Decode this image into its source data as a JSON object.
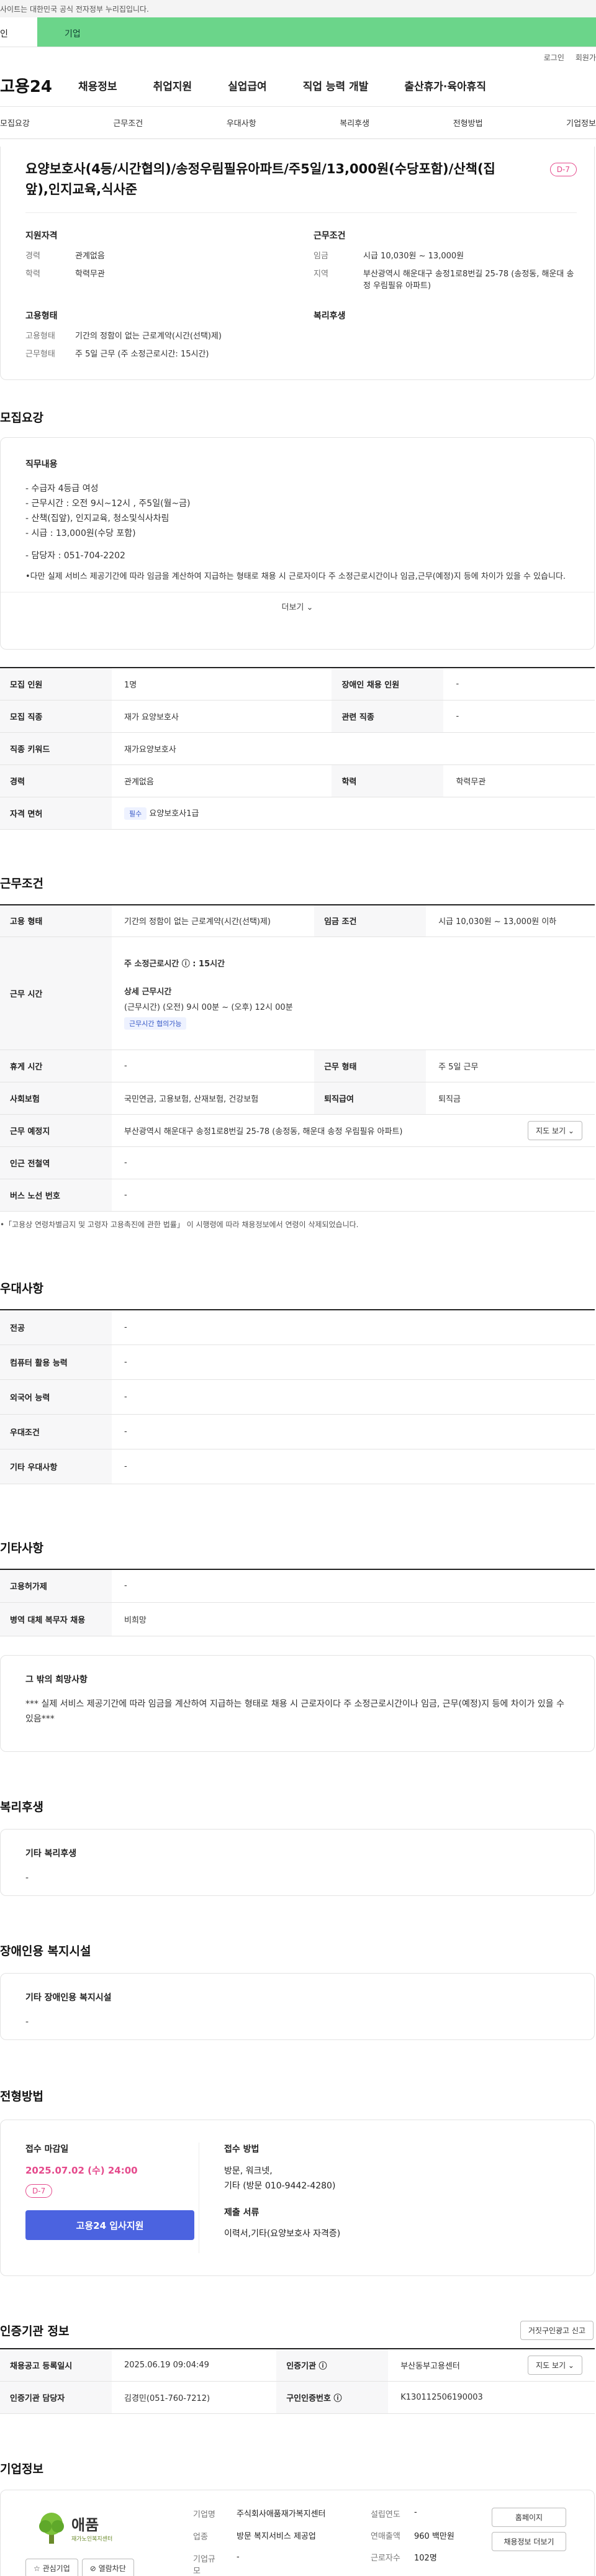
{
  "topbar": {
    "notice": "사이트는 대한민국 공식 전자정부 누리집입니다."
  },
  "typebar": {
    "personal": "인",
    "company": "기업"
  },
  "util": {
    "login": "로그인",
    "signup": "회원가"
  },
  "gnb": {
    "logo": "고용24",
    "menu": [
      "채용정보",
      "취업지원",
      "실업급여",
      "직업 능력 개발",
      "출산휴가·육아휴직"
    ]
  },
  "tabs": [
    "모집요강",
    "근무조건",
    "우대사항",
    "복리후생",
    "전형방법",
    "기업정보"
  ],
  "summary": {
    "title": "요양보호사(4등/시간협의)/송정우림필유아파트/주5일/13,000원(수당포함)/산책(집앞),인지교육,식사준",
    "dday": "D-7",
    "qual_title": "지원자격",
    "qual": [
      {
        "k": "경력",
        "v": "관계없음"
      },
      {
        "k": "학력",
        "v": "학력무관"
      }
    ],
    "work_title": "근무조건",
    "work": [
      {
        "k": "임금",
        "v": "시급 10,030원 ~ 13,000원"
      },
      {
        "k": "지역",
        "v": "부산광역시 해운대구 송정1로8번길 25-78 (송정동, 해운대 송정 우림필유 아파트)"
      }
    ],
    "emp_title": "고용형태",
    "emp": [
      {
        "k": "고용형태",
        "v": "기간의 정함이 없는 근로계약(시간(선택)제)"
      },
      {
        "k": "근무형태",
        "v": "주 5일 근무 (주 소정근로시간: 15시간)"
      }
    ],
    "welfare_title": "복리후생"
  },
  "recruit": {
    "section": "모집요강",
    "head": "직무내용",
    "lines": [
      "- 수급자 4등급 여성",
      "- 근무시간 : 오전 9시~12시 , 주5일(월~금)",
      "- 산책(집앞), 인지교육, 청소및식사차림",
      "- 시급 : 13,000원(수당 포함)",
      "",
      "- 담당자 : 051-704-2202",
      "",
      "•다만 실제 서비스 제공기간에 따라 임금을 계산하여 지급하는 형태로 채용 시 근로자이다 주 소정근로시간이나 임금,근무(예정)지 등에 차이가 있을 수 있습니다."
    ],
    "more": "더보기 ⌄",
    "table": [
      {
        "k1": "모집 인원",
        "v1": "1명",
        "k2": "장애인 채용 인원",
        "v2": "-"
      },
      {
        "k1": "모집 직종",
        "v1": "재가 요양보호사",
        "k2": "관련 직종",
        "v2": "-"
      },
      {
        "k1": "직종 키워드",
        "v1": "재가요양보호사"
      },
      {
        "k1": "경력",
        "v1": "관계없음",
        "k2": "학력",
        "v2": "학력무관"
      },
      {
        "k1": "자격 면허",
        "tag": "필수",
        "v1": "요양보호사1급"
      }
    ]
  },
  "workcond": {
    "section": "근무조건",
    "emp_type_k": "고용 형태",
    "emp_type_v": "기간의 정함이 없는 근로계약(시간(선택)제)",
    "wage_k": "임금 조건",
    "wage_v": "시급 10,030원 ~ 13,000원 이하",
    "hours_k": "근무 시간",
    "hours_weekly": "주 소정근로시간 ⓘ : 15시간",
    "hours_detail_h": "상세 근무시간",
    "hours_detail_v": "(근무시간) (오전) 9시 00분 ~ (오후) 12시 00분",
    "hours_tag": "근무시간 협의가능",
    "rest_k": "휴게 시간",
    "rest_v": "-",
    "form_k": "근무 형태",
    "form_v": "주 5일 근무",
    "ins_k": "사회보험",
    "ins_v": "국민연금, 고용보험, 산재보험, 건강보험",
    "sev_k": "퇴직급여",
    "sev_v": "퇴직금",
    "place_k": "근무 예정지",
    "place_v": "부산광역시 해운대구 송정1로8번길 25-78 (송정동, 해운대 송정 우림필유 아파트)",
    "map": "지도 보기 ⌄",
    "station_k": "인근 전철역",
    "station_v": "-",
    "bus_k": "버스 노선 번호",
    "bus_v": "-",
    "note": "•「고용상 연령차별금지 및 고령자 고용촉진에 관한 법률」 이 시행령에 따라 채용정보에서 연령이 삭제되었습니다."
  },
  "pref": {
    "section": "우대사항",
    "rows": [
      {
        "k": "전공",
        "v": "-"
      },
      {
        "k": "컴퓨터 활용 능력",
        "v": "-"
      },
      {
        "k": "외국어 능력",
        "v": "-"
      },
      {
        "k": "우대조건",
        "v": "-"
      },
      {
        "k": "기타 우대사항",
        "v": "-"
      }
    ]
  },
  "etc": {
    "section": "기타사항",
    "rows": [
      {
        "k": "고용허가제",
        "v": "-"
      },
      {
        "k": "병역 대체 복무자 채용",
        "v": "비희망"
      }
    ],
    "box_h": "그 밖의 희망사항",
    "box_v": "*** 실제 서비스 제공기간에 따라 임금을 계산하여 지급하는 형태로 채용 시 근로자이다 주 소정근로시간이나 임금, 근무(예정)지 등에 차이가 있을 수 있음***"
  },
  "welfare": {
    "section": "복리후생",
    "h": "기타 복리후생",
    "v": "-"
  },
  "disab": {
    "section": "장애인용 복지시설",
    "h": "기타 장애인용 복지시설",
    "v": "-"
  },
  "apply": {
    "section": "전형방법",
    "deadline_h": "접수 마감일",
    "deadline_v": "2025.07.02 (수) 24:00",
    "dday": "D-7",
    "btn": "고용24 입사지원",
    "method_h": "접수 방법",
    "method_v1": "방문, 워크넷,",
    "method_v2": "기타 (방문 010-9442-4280)",
    "docs_h": "제출 서류",
    "docs_v": "이력서,기타(요양보호사 자격증)"
  },
  "cert": {
    "section": "인증기관 정보",
    "report": "거짓구인광고 신고",
    "rows": [
      {
        "k1": "채용공고 등록일시",
        "v1": "2025.06.19 09:04:49",
        "k2": "인증기관 ⓘ",
        "v2": "부산동부고용센터",
        "btn": "지도 보기 ⌄"
      },
      {
        "k1": "인증기관 담당자",
        "v1": "김경민(051-760-7212)",
        "k2": "구인인증번호 ⓘ",
        "v2": "K130112506190003"
      }
    ]
  },
  "company": {
    "section": "기업정보",
    "logo": "애품",
    "logo_sub": "재가노인복지센터",
    "fav": "☆ 관심기업",
    "block": "⊘ 열람차단",
    "name_k": "기업명",
    "name_v": "주식회사애품재가복지센터",
    "ind_k": "업종",
    "ind_v": "방문 복지서비스 제공업",
    "size_k": "기업규모",
    "size_v": "-",
    "est_k": "설립연도",
    "est_v": "-",
    "sales_k": "연매출액",
    "sales_v": "960 백만원",
    "emp_k": "근로자수",
    "emp_v": "102명",
    "home": "홈페이지",
    "jobs": "채용정보 더보기"
  }
}
